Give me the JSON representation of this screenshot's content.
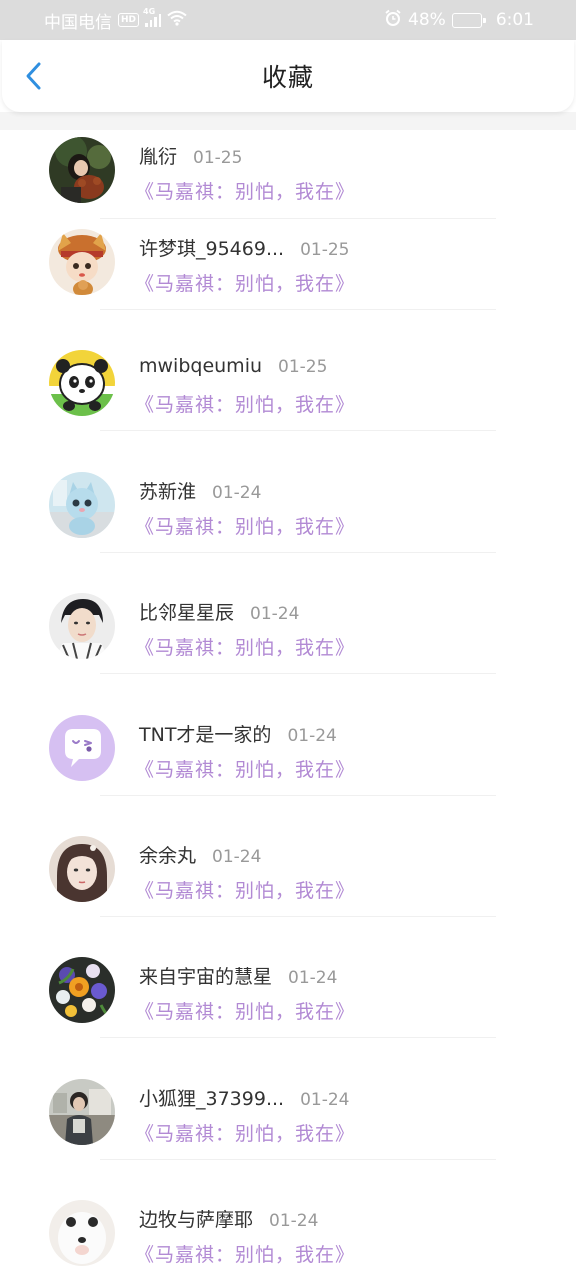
{
  "status_bar": {
    "carrier": "中国电信",
    "hd": "HD",
    "network": "4G",
    "battery": "48%",
    "time": "6:01",
    "icons": [
      "signal-icon",
      "wifi-icon",
      "alarm-icon",
      "battery-icon"
    ]
  },
  "header": {
    "title": "收藏",
    "back_icon": "chevron-left-icon",
    "accent_color": "#2f8fe0"
  },
  "colors": {
    "quote": "#b28ad4",
    "name": "#333333",
    "date": "#999999"
  },
  "favorites": [
    {
      "name": "胤衍",
      "date": "01-25",
      "quote": "《马嘉祺：别怕，我在》",
      "avatar": "girl-with-bear-photo"
    },
    {
      "name": "许梦琪_95469...",
      "date": "01-25",
      "quote": "《马嘉祺：别怕，我在》",
      "avatar": "cartoon-tiger-hat-boy"
    },
    {
      "name": "mwibqeumiu",
      "date": "01-25",
      "quote": "《马嘉祺：别怕，我在》",
      "avatar": "cartoon-panda"
    },
    {
      "name": "苏新淮",
      "date": "01-24",
      "quote": "《马嘉祺：别怕，我在》",
      "avatar": "blue-plush-cat"
    },
    {
      "name": "比邻星星辰",
      "date": "01-24",
      "quote": "《马嘉祺：别怕，我在》",
      "avatar": "boy-portrait-photo"
    },
    {
      "name": "TNT才是一家的",
      "date": "01-24",
      "quote": "《马嘉祺：别怕，我在》",
      "avatar": "default-chat-bubble-avatar"
    },
    {
      "name": "余余丸",
      "date": "01-24",
      "quote": "《马嘉祺：别怕，我在》",
      "avatar": "girl-portrait-photo"
    },
    {
      "name": "来自宇宙的慧星",
      "date": "01-24",
      "quote": "《马嘉祺：别怕，我在》",
      "avatar": "flower-bouquet-photo"
    },
    {
      "name": "小狐狸_37399...",
      "date": "01-24",
      "quote": "《马嘉祺：别怕，我在》",
      "avatar": "person-indoor-photo"
    },
    {
      "name": "边牧与萨摩耶",
      "date": "01-24",
      "quote": "《马嘉祺：别怕，我在》",
      "avatar": "white-dog-photo"
    }
  ]
}
